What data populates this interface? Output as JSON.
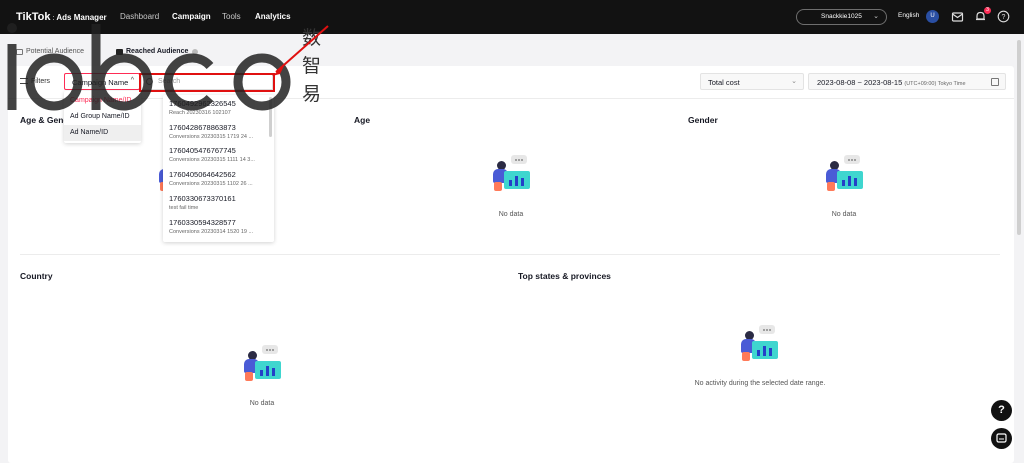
{
  "header": {
    "brand": "TikTok",
    "brand_sep": ":",
    "brand_sub": "Ads Manager",
    "nav": [
      "Dashboard",
      "Campaign",
      "Tools",
      "Analytics"
    ],
    "account": "Snackkie1025",
    "language": "English",
    "avatar_letter": "U",
    "notification_count": "3",
    "icons": [
      "mail-icon",
      "bell-icon",
      "help-icon"
    ]
  },
  "tabs": [
    {
      "label": "Potential Audience",
      "active": false
    },
    {
      "label": "Reached Audience",
      "active": true
    }
  ],
  "toolbar": {
    "filters_label": "Filters",
    "dimension_selected": "Campaign Name",
    "search_placeholder": "Search",
    "metric_selected": "Total cost",
    "date_range": "2023-08-08  ~  2023-08-15",
    "timezone": "(UTC+09:00) Tokyo Time"
  },
  "dimension_options": [
    "Campaign Name/ID",
    "Ad Group Name/ID",
    "Ad Name/ID"
  ],
  "search_results": [
    {
      "id": "1760492962326545",
      "name": "Reach 20230316 102107"
    },
    {
      "id": "1760428678863873",
      "name": "Conversions 20230315 1719 24 ..."
    },
    {
      "id": "1760405476767745",
      "name": "Conversions 20230315 1111 14 3..."
    },
    {
      "id": "1760405064642562",
      "name": "Conversions 20230315 1102 26 ..."
    },
    {
      "id": "1760330673370161",
      "name": "test fail time"
    },
    {
      "id": "1760330594328577",
      "name": "Conversions 20230314 1520 19 ..."
    }
  ],
  "sections": {
    "age_gender": {
      "title": "Age & Gender"
    },
    "age": {
      "title": "Age",
      "empty": "No data"
    },
    "gender": {
      "title": "Gender",
      "empty": "No data"
    },
    "country": {
      "title": "Country",
      "empty": "No data"
    },
    "states": {
      "title": "Top states & provinces",
      "empty": "No activity during the selected date range."
    }
  },
  "watermark": {
    "text": "iobco",
    "cjk": "数智易"
  },
  "colors": {
    "brand": "#fe2c55",
    "topbar": "#121212",
    "annotation": "#e01010"
  }
}
